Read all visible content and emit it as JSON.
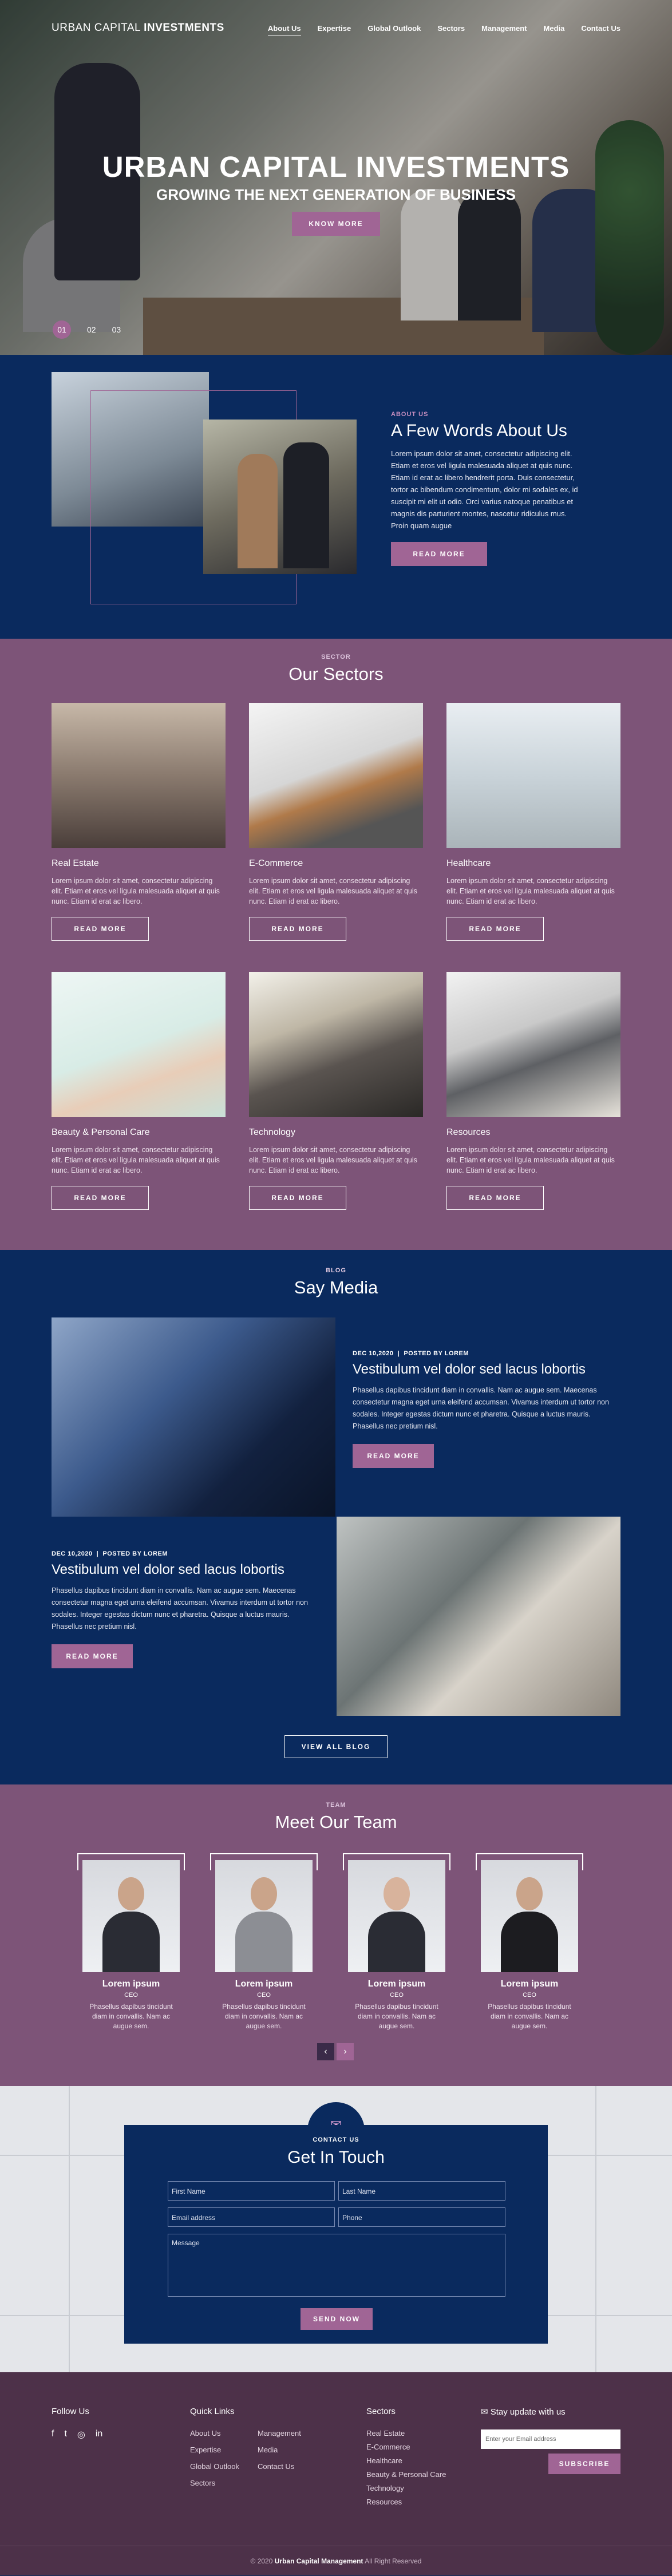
{
  "header": {
    "brand_light": "URBAN CAPITAL ",
    "brand_bold": "INVESTMENTS",
    "nav": [
      "About Us",
      "Expertise",
      "Global Outlook",
      "Sectors",
      "Management",
      "Media",
      "Contact Us"
    ]
  },
  "hero": {
    "title": "URBAN CAPITAL INVESTMENTS",
    "subtitle": "GROWING THE NEXT GENERATION OF BUSINESS",
    "button": "KNOW MORE",
    "slides": [
      "01",
      "02",
      "03"
    ]
  },
  "about": {
    "kicker": "ABOUT US",
    "title": "A Few Words About Us",
    "body": "Lorem ipsum dolor sit amet, consectetur adipiscing elit. Etiam et eros vel ligula malesuada aliquet at quis nunc. Etiam id erat ac libero hendrerit porta. Duis consectetur, tortor ac bibendum condimentum, dolor mi sodales ex, id suscipit mi elit ut odio. Orci varius natoque penatibus et magnis dis parturient montes, nascetur ridiculus mus. Proin quam augue",
    "button": "READ MORE"
  },
  "sectors": {
    "kicker": "SECTOR",
    "title": "Our Sectors",
    "button": "READ MORE",
    "items": [
      {
        "name": "Real Estate",
        "body": "Lorem ipsum dolor sit amet, consectetur adipiscing elit. Etiam et eros vel ligula malesuada aliquet at quis nunc. Etiam id erat ac libero."
      },
      {
        "name": "E-Commerce",
        "body": "Lorem ipsum dolor sit amet, consectetur adipiscing elit. Etiam et eros vel ligula malesuada aliquet at quis nunc. Etiam id erat ac libero."
      },
      {
        "name": "Healthcare",
        "body": "Lorem ipsum dolor sit amet, consectetur adipiscing elit. Etiam et eros vel ligula malesuada aliquet at quis nunc. Etiam id erat ac libero."
      },
      {
        "name": "Beauty & Personal Care",
        "body": "Lorem ipsum dolor sit amet, consectetur adipiscing elit. Etiam et eros vel ligula malesuada aliquet at quis nunc. Etiam id erat ac libero."
      },
      {
        "name": "Technology",
        "body": "Lorem ipsum dolor sit amet, consectetur adipiscing elit. Etiam et eros vel ligula malesuada aliquet at quis nunc. Etiam id erat ac libero."
      },
      {
        "name": "Resources",
        "body": "Lorem ipsum dolor sit amet, consectetur adipiscing elit. Etiam et eros vel ligula malesuada aliquet at quis nunc. Etiam id erat ac libero."
      }
    ]
  },
  "media": {
    "kicker": "BLOG",
    "title": "Say Media",
    "posts": [
      {
        "date": "DEC 10,2020",
        "by": "POSTED BY LOREM",
        "title": "Vestibulum vel dolor sed lacus lobortis",
        "body": "Phasellus dapibus tincidunt diam in convallis. Nam ac augue sem. Maecenas consectetur magna eget urna eleifend accumsan. Vivamus interdum ut tortor non sodales. Integer egestas dictum nunc et pharetra. Quisque a luctus mauris. Phasellus nec pretium nisl.",
        "button": "READ MORE"
      },
      {
        "date": "DEC 10,2020",
        "by": "POSTED BY LOREM",
        "title": "Vestibulum vel dolor sed lacus lobortis",
        "body": "Phasellus dapibus tincidunt diam in convallis. Nam ac augue sem. Maecenas consectetur magna eget urna eleifend accumsan. Vivamus interdum ut tortor non sodales. Integer egestas dictum nunc et pharetra. Quisque a luctus mauris. Phasellus nec pretium nisl.",
        "button": "READ MORE"
      }
    ],
    "view_all": "VIEW ALL BLOG"
  },
  "team": {
    "kicker": "TEAM",
    "title": "Meet Our Team",
    "members": [
      {
        "name": "Lorem ipsum",
        "role": "CEO",
        "body": "Phasellus dapibus tincidunt diam in convallis. Nam ac augue sem."
      },
      {
        "name": "Lorem ipsum",
        "role": "CEO",
        "body": "Phasellus dapibus tincidunt diam in convallis. Nam ac augue sem."
      },
      {
        "name": "Lorem ipsum",
        "role": "CEO",
        "body": "Phasellus dapibus tincidunt diam in convallis. Nam ac augue sem."
      },
      {
        "name": "Lorem ipsum",
        "role": "CEO",
        "body": "Phasellus dapibus tincidunt diam in convallis. Nam ac augue sem."
      }
    ],
    "prev": "‹",
    "next": "›"
  },
  "contact": {
    "kicker": "CONTACT US",
    "title": "Get In Touch",
    "first_name": "First Name",
    "last_name": "Last Name",
    "email": "Email address",
    "phone": "Phone",
    "message": "Message",
    "button": "SEND NOW",
    "icon": "mail-icon"
  },
  "footer": {
    "follow_title": "Follow Us",
    "social": [
      "f",
      "t",
      "◎",
      "in"
    ],
    "quick_title": "Quick Links",
    "quick_links": [
      "About Us",
      "Management",
      "Expertise",
      "Media",
      "Global Outlook",
      "Contact Us",
      "Sectors"
    ],
    "sectors_title": "Sectors",
    "sectors": [
      "Real Estate",
      "E-Commerce",
      "Healthcare",
      "Beauty & Personal Care",
      "Technology",
      "Resources"
    ],
    "newsletter_title": "Stay update with us",
    "newsletter_placeholder": "Enter your Email address",
    "newsletter_button": "SUBSCRIBE",
    "copyright_pre": "© 2020 ",
    "copyright_brand": "Urban Capital Management",
    "copyright_post": " All Right Reserved"
  },
  "colors": {
    "navy": "#0a2a5e",
    "mauve": "#7d5478",
    "accent": "#a06595",
    "footer": "#4d3149"
  }
}
